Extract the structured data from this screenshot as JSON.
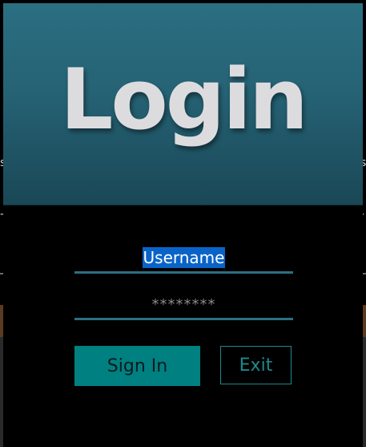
{
  "header": {
    "title": "Login"
  },
  "form": {
    "username": {
      "value": "Username",
      "selected": true
    },
    "password": {
      "mask": "********"
    },
    "sign_in_label": "Sign In",
    "exit_label": "Exit"
  },
  "colors": {
    "header_top": "#2b6f82",
    "header_bottom": "#1a4756",
    "accent": "#008080",
    "field_underline": "#2b6f82",
    "selection": "#0a64c8"
  }
}
